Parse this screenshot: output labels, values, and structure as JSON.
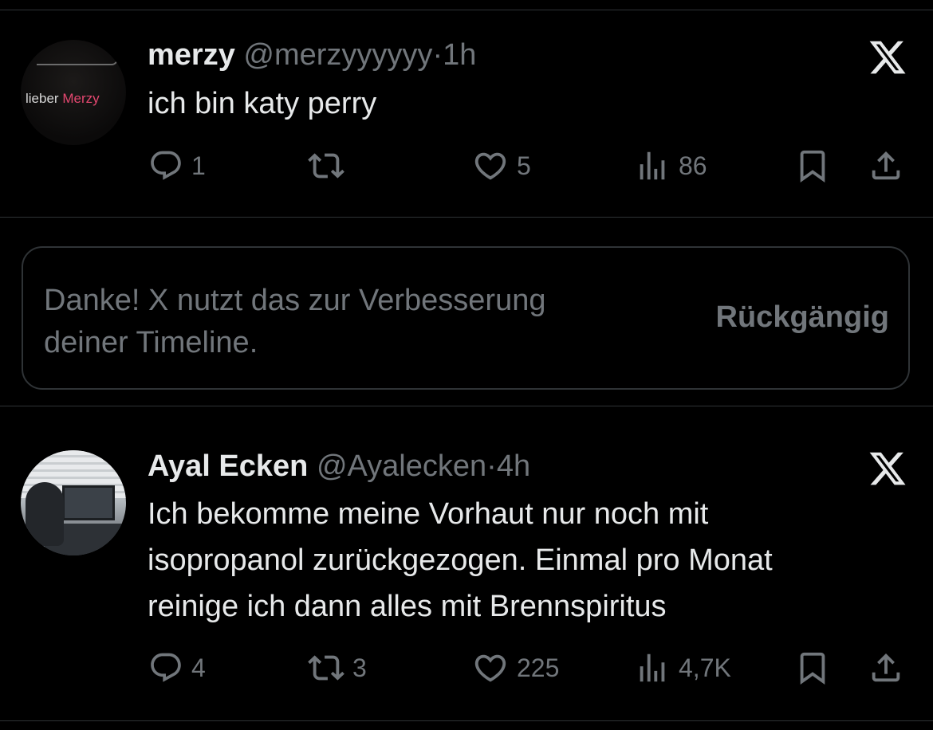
{
  "tweets": [
    {
      "avatar_text_1": "lieber",
      "avatar_text_2": "Merzy",
      "name": "merzy",
      "handle": "@merzyyyyyy",
      "separator": "·",
      "time": "1h",
      "text_lines": [
        "ich bin katy perry"
      ],
      "replies": "1",
      "reposts": "",
      "likes": "5",
      "views": "86"
    },
    {
      "name": "Ayal Ecken",
      "handle": "@Ayalecken",
      "separator": "·",
      "time": "4h",
      "text_lines": [
        "Ich bekomme meine Vorhaut nur noch mit",
        "isopropanol zurückgezogen. Einmal pro Monat",
        "reinige ich dann alles mit Brennspiritus"
      ],
      "replies": "4",
      "reposts": "3",
      "likes": "225",
      "views": "4,7K"
    }
  ],
  "notice": {
    "line1": "Danke! X nutzt das zur Verbesserung",
    "line2": "deiner Timeline.",
    "undo_label": "Rückgängig"
  },
  "icons": {
    "reply": "reply-icon",
    "repost": "repost-icon",
    "like": "heart-icon",
    "views": "views-icon",
    "bookmark": "bookmark-icon",
    "share": "share-icon",
    "dismiss": "x-logo-icon"
  },
  "colors": {
    "background": "#000000",
    "text": "#e7e9ea",
    "secondary": "#71767b",
    "border": "#2f3336"
  }
}
